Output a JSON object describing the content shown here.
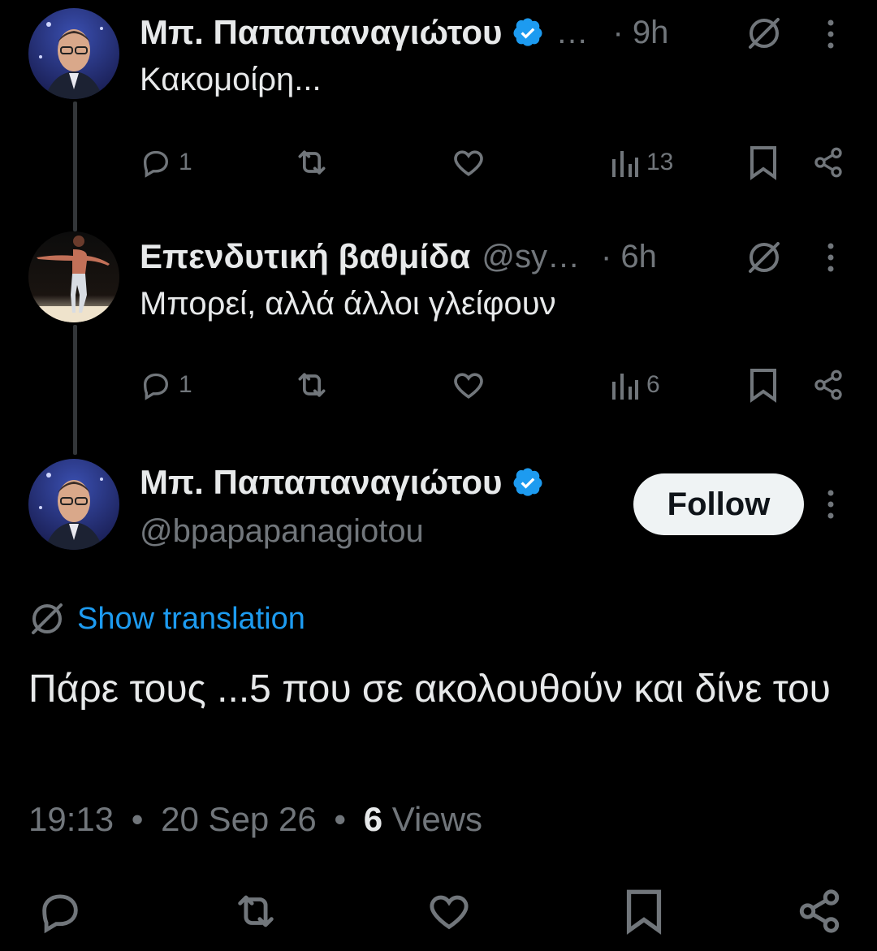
{
  "replies": [
    {
      "author_name": "Μπ. Παπαπαναγιώτου",
      "handle_truncated": "…",
      "time": "· 9h",
      "text": "Κακομοίρη...",
      "counts": {
        "replies": "1",
        "views": "13"
      }
    },
    {
      "author_name": "Επενδυτική βαθμίδα",
      "handle_truncated": "@sy…",
      "time": "· 6h",
      "text": "Μπορεί, αλλά άλλοι γλείφουν",
      "counts": {
        "replies": "1",
        "views": "6"
      }
    }
  ],
  "main_tweet": {
    "author_name": "Μπ. Παπαπαναγιώτου",
    "handle": "@bpapapanagiotou",
    "follow_label": "Follow",
    "show_translation": "Show translation",
    "text": "Πάρε τους ...5 που σε ακολουθούν και δίνε του",
    "time": "19:13",
    "date": "20 Sep 26",
    "views_count": "6",
    "views_label": "Views",
    "sep": "•"
  },
  "colors": {
    "background": "#000000",
    "text": "#e7e9ea",
    "muted": "#71767b",
    "accent": "#1d9bf0",
    "verified": "#1d9bf0"
  },
  "icons": [
    "reply-icon",
    "retweet-icon",
    "like-icon",
    "views-icon",
    "bookmark-icon",
    "share-icon",
    "grok-icon",
    "more-icon",
    "verified-badge-icon"
  ]
}
